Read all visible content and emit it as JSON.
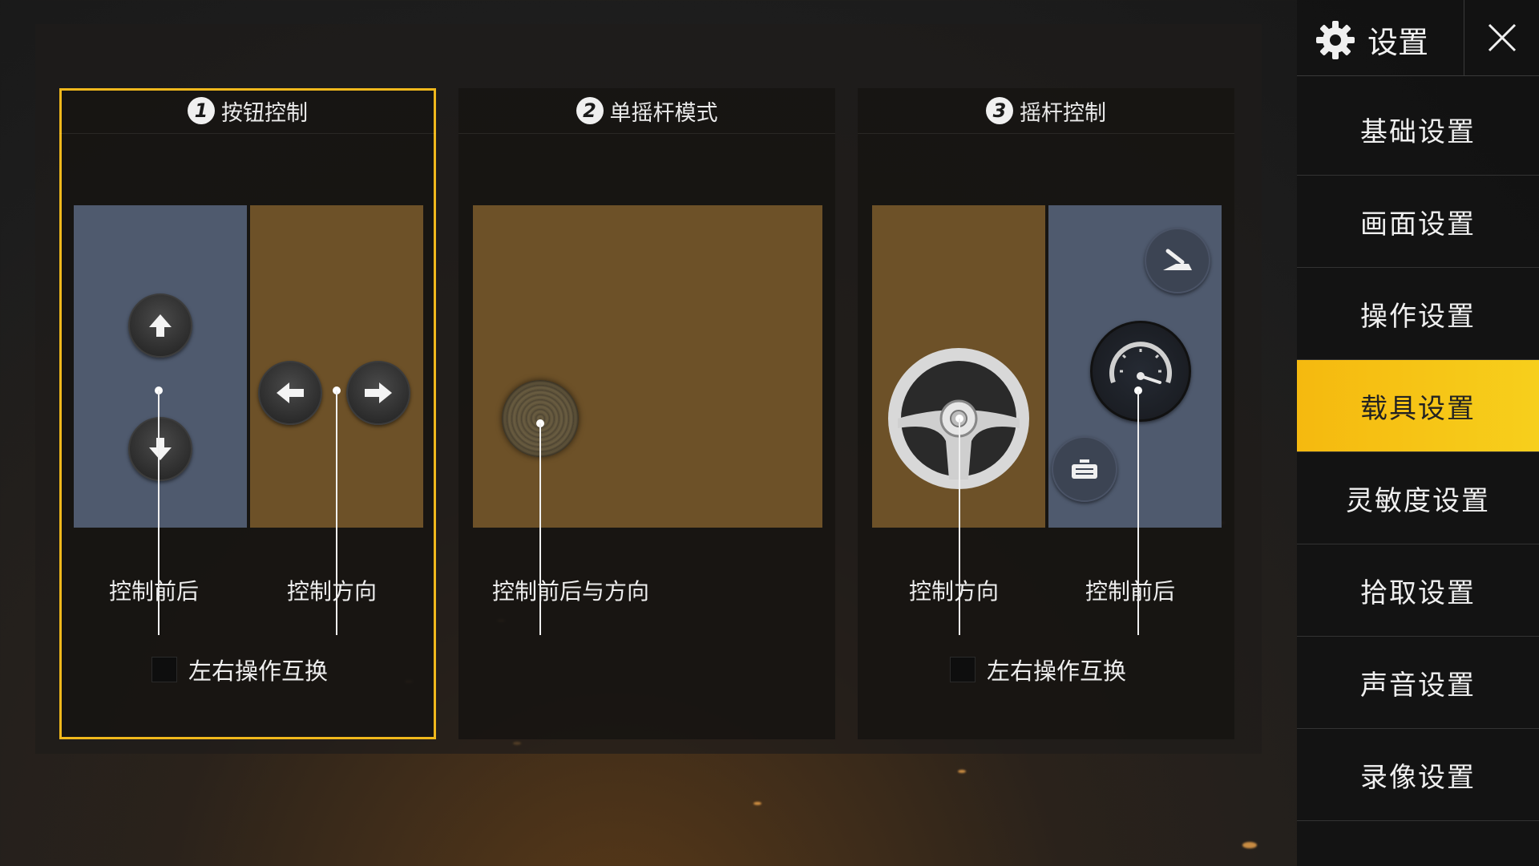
{
  "colors": {
    "accent": "#f0b81c",
    "blue_zone": "#4f5a6e",
    "brown_zone": "#6d5128"
  },
  "cards": [
    {
      "number": "1",
      "title": "按钮控制",
      "label_left": "控制前后",
      "label_right": "控制方向",
      "checkbox_label": "左右操作互换",
      "checked": false,
      "selected": true
    },
    {
      "number": "2",
      "title": "单摇杆模式",
      "label": "控制前后与方向",
      "selected": false
    },
    {
      "number": "3",
      "title": "摇杆控制",
      "label_left": "控制方向",
      "label_right": "控制前后",
      "checkbox_label": "左右操作互换",
      "checked": false,
      "selected": false
    }
  ],
  "sidebar": {
    "title": "设置",
    "items": [
      {
        "label": "基础设置",
        "active": false
      },
      {
        "label": "画面设置",
        "active": false
      },
      {
        "label": "操作设置",
        "active": false
      },
      {
        "label": "载具设置",
        "active": true
      },
      {
        "label": "灵敏度设置",
        "active": false
      },
      {
        "label": "拾取设置",
        "active": false
      },
      {
        "label": "声音设置",
        "active": false
      },
      {
        "label": "录像设置",
        "active": false
      }
    ]
  },
  "icons": [
    "gear-icon",
    "close-icon",
    "arrow-up-icon",
    "arrow-down-icon",
    "arrow-left-icon",
    "arrow-right-icon",
    "joystick-icon",
    "steering-wheel-icon",
    "speedometer-icon",
    "handbrake-icon",
    "brake-pedal-icon"
  ]
}
